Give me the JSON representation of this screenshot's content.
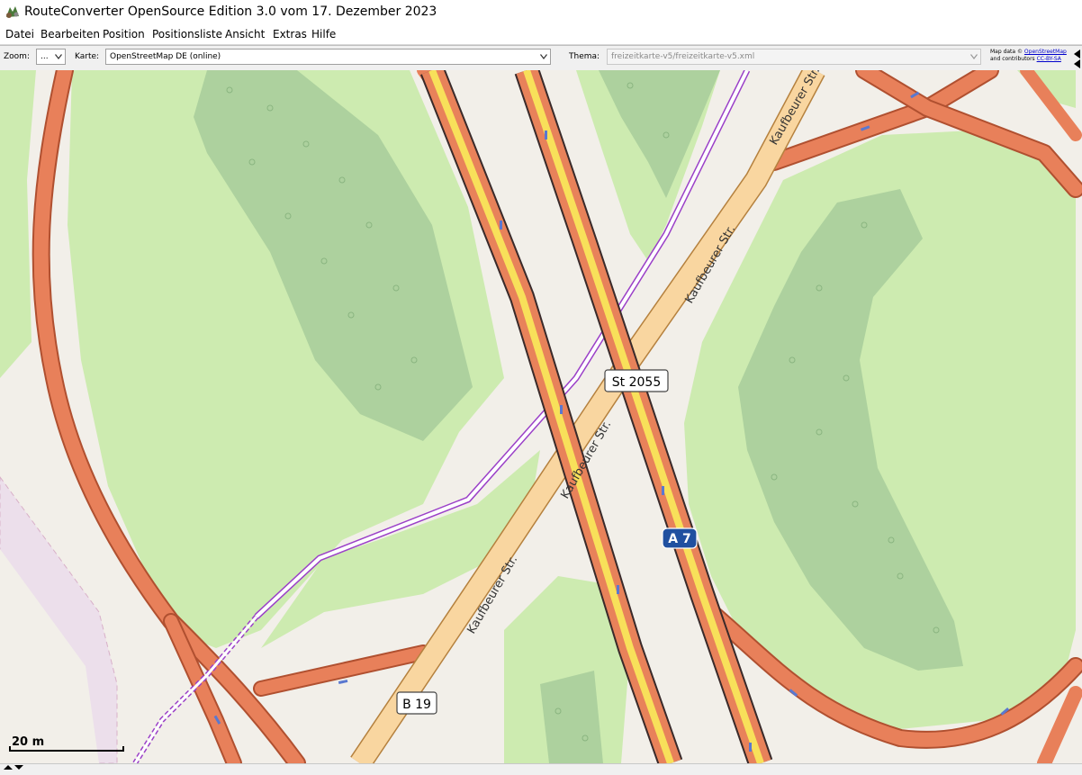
{
  "window": {
    "title": "RouteConverter OpenSource Edition 3.0 vom 17. Dezember 2023",
    "icon": "routeconverter-logo-icon"
  },
  "menu": [
    "Datei",
    "Bearbeiten",
    "Position",
    "Positionsliste",
    "Ansicht",
    "Extras",
    "Hilfe"
  ],
  "toolbar": {
    "zoom_label": "Zoom:",
    "zoom_value": "...",
    "map_label": "Karte:",
    "map_value": "OpenStreetMap DE (online)",
    "theme_label": "Thema:",
    "theme_value": "freizeitkarte-v5/freizeitkarte-v5.xml"
  },
  "attribution": {
    "prefix": "Map data ©",
    "osm_link": "OpenStreetMap",
    "middle": "and contributors",
    "license_link": "CC-BY-SA"
  },
  "map": {
    "road_labels": [
      "Kaufbeurer Str.",
      "Kaufbeurer Str.",
      "Kaufbeurer Str.",
      "Kaufbeurer Str."
    ],
    "shields": {
      "state_road": "St 2055",
      "motorway": "A 7",
      "federal_road": "B 19"
    },
    "scale": "20 m",
    "colors": {
      "meadow": "#cdebb0",
      "forest": "#add19e",
      "motorway_casing": "#e8825a",
      "motorway_fill": "#f8e05a",
      "trunk": "#e8805a",
      "secondary": "#f9d6a0",
      "railway": "#9b40c8",
      "background": "#f2efe9",
      "residential_area": "#ecdfeb"
    }
  }
}
